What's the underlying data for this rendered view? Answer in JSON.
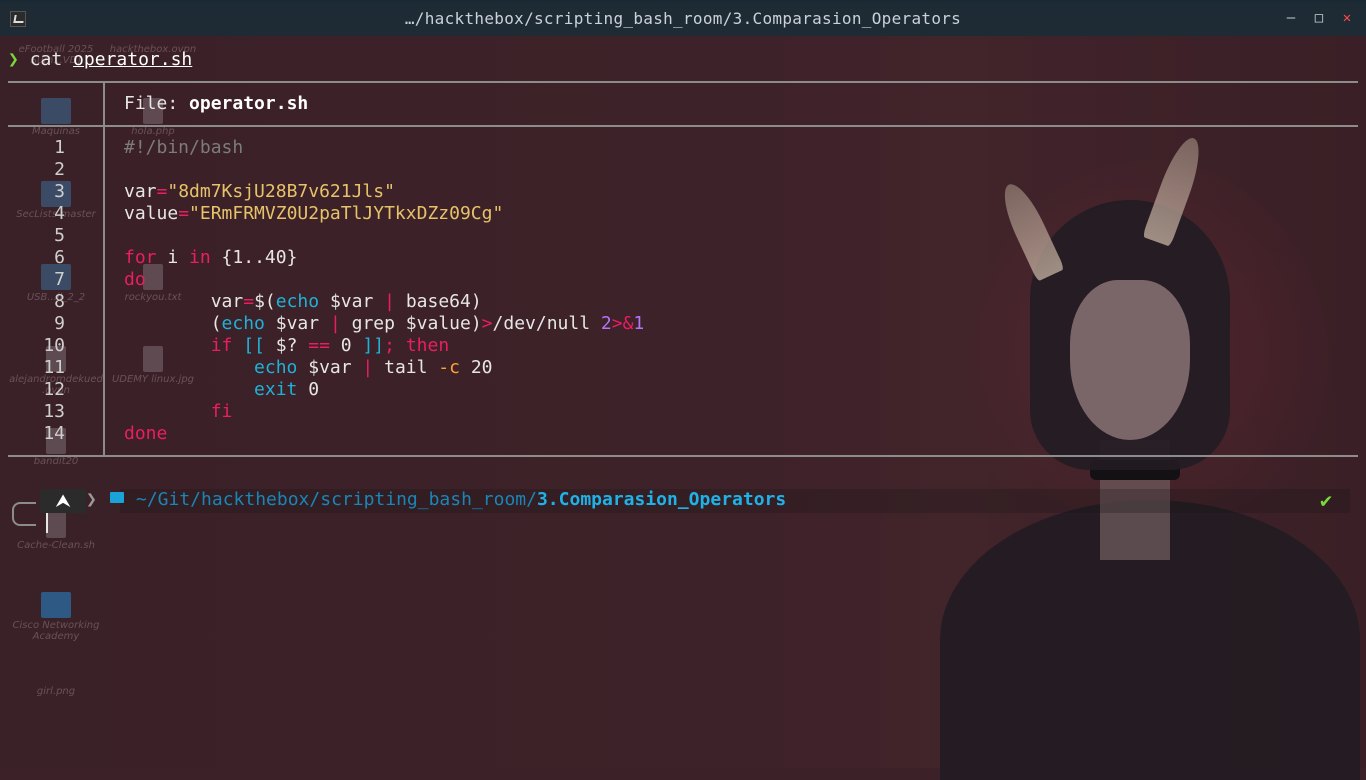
{
  "window": {
    "title": "…/hackthebox/scripting_bash_room/3.Comparasion_Operators",
    "controls": {
      "minimize": "–",
      "maximize": "□",
      "close": "✕"
    }
  },
  "desktop": {
    "icons": [
      {
        "label": "eFootball 2025",
        "sub": "Sum...VD]",
        "kind": "file"
      },
      {
        "label": "hackthebox.ovpn",
        "sub": "",
        "kind": "file"
      },
      {
        "label": "Maquinas",
        "sub": "",
        "kind": "folder"
      },
      {
        "label": "hola.php",
        "sub": "",
        "kind": "file"
      },
      {
        "label": "SecLists-master",
        "sub": "",
        "kind": "folder"
      },
      {
        "label": "USB...ll_2_2",
        "sub": "",
        "kind": "folder"
      },
      {
        "label": "rockyou.txt",
        "sub": "",
        "kind": "file"
      },
      {
        "label": "alejandromdekued",
        "sub": ".ovpn",
        "kind": "file"
      },
      {
        "label": "UDEMY linux.jpg",
        "sub": "",
        "kind": "file"
      },
      {
        "label": "bandit20",
        "sub": "",
        "kind": "file"
      },
      {
        "label": "Cache-Clean.sh",
        "sub": "",
        "kind": "file"
      },
      {
        "label": "Cisco Networking",
        "sub": "Academy",
        "kind": "cisco"
      },
      {
        "label": "girl.png",
        "sub": "",
        "kind": "file"
      }
    ]
  },
  "terminal": {
    "prompt_symbol": "❯",
    "command": "cat",
    "argument": "operator.sh",
    "bat": {
      "file_label": "File: ",
      "file_name": "operator.sh",
      "line_numbers": [
        "1",
        "2",
        "3",
        "4",
        "5",
        "6",
        "7",
        "8",
        "9",
        "10",
        "11",
        "12",
        "13",
        "14"
      ]
    },
    "status": {
      "user_icon": "⮝",
      "arrow": "❯",
      "path_prefix": "~/Git/hackthebox/scripting_bash_room/",
      "path_current": "3.Comparasion_Operators",
      "check": "✔"
    }
  },
  "colors": {
    "keyword": "#e91e63",
    "string": "#e6c36a",
    "command": "#1fb2d8",
    "comment": "#7c7c7c",
    "prompt_ok": "#7bd83a",
    "path": "#1fb2e8"
  }
}
